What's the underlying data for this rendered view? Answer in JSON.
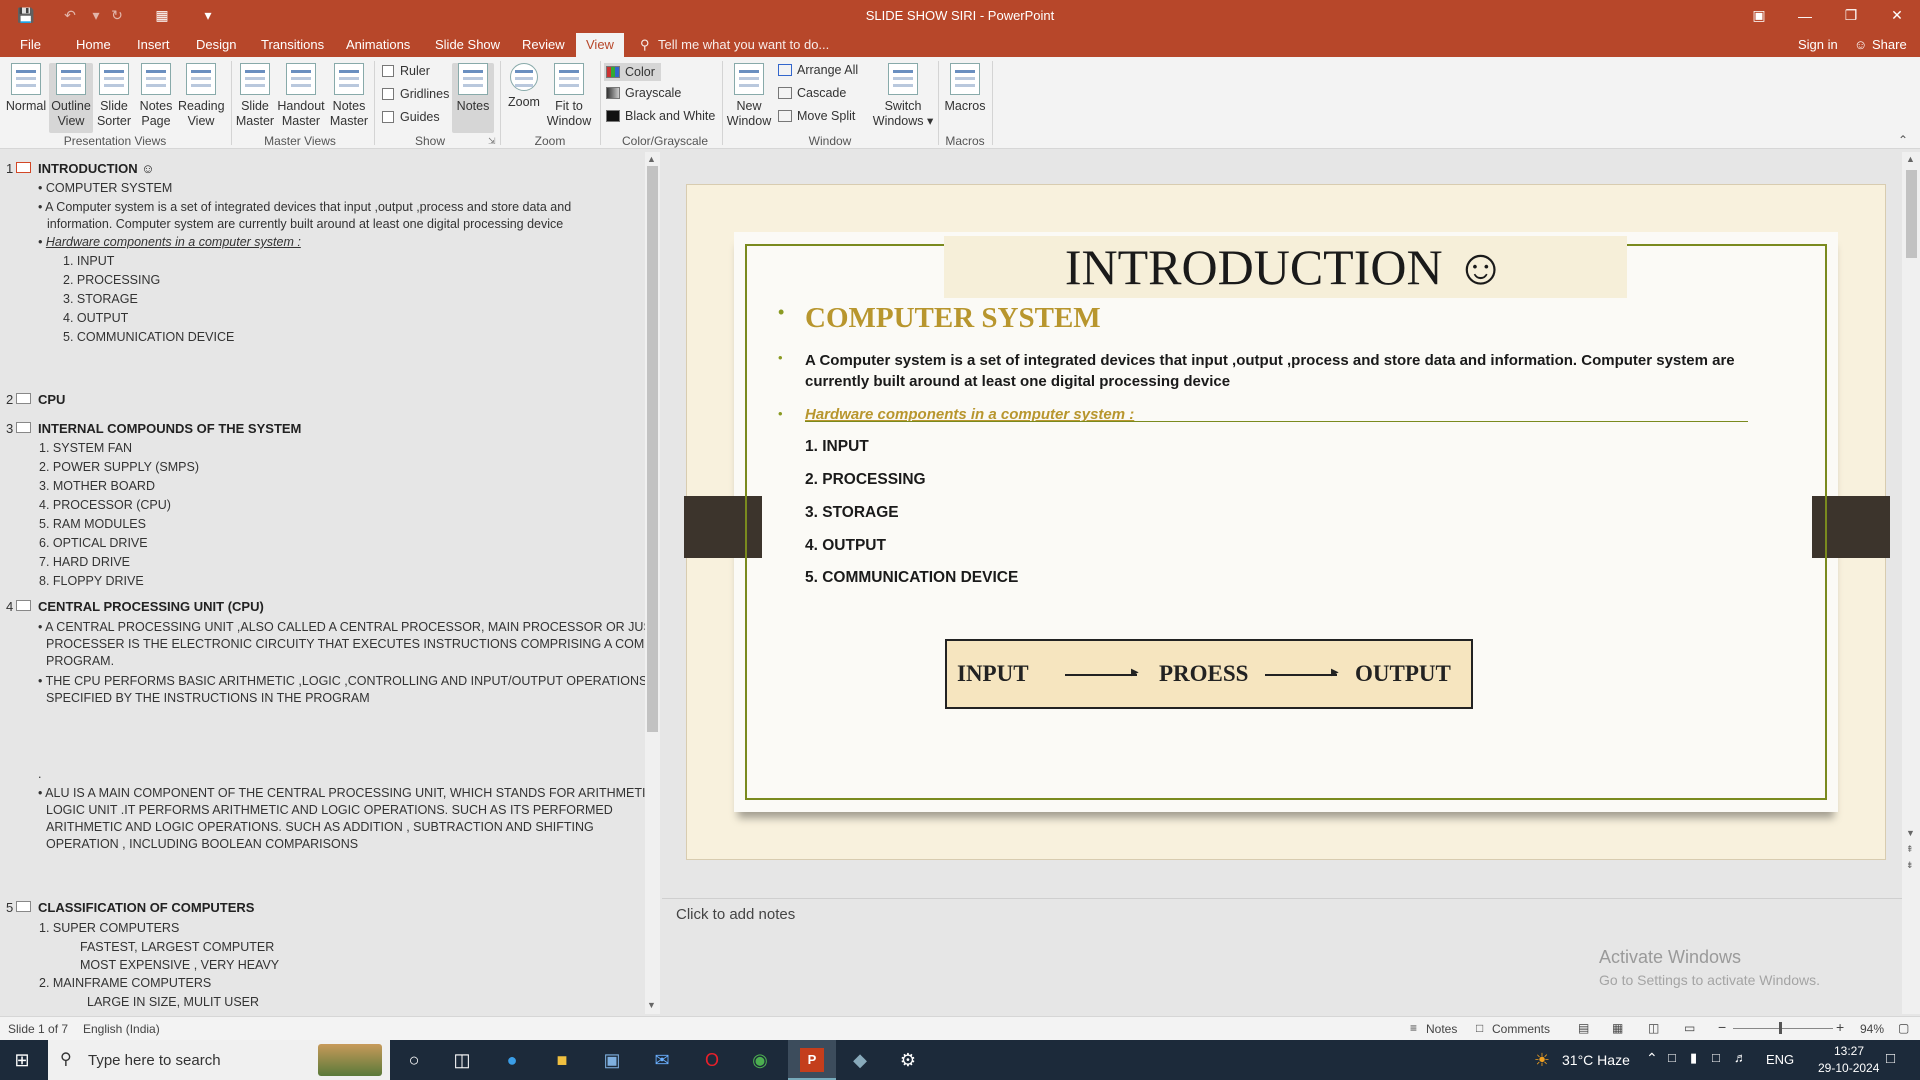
{
  "window": {
    "title": "SLIDE SHOW SIRI - PowerPoint",
    "sign_in": "Sign in",
    "share": "Share"
  },
  "tabs": [
    "File",
    "Home",
    "Insert",
    "Design",
    "Transitions",
    "Animations",
    "Slide Show",
    "Review",
    "View"
  ],
  "tell_me": "Tell me what you want to do...",
  "ribbon": {
    "presentation_views": {
      "label": "Presentation Views",
      "buttons": [
        {
          "label1": "Normal",
          "label2": ""
        },
        {
          "label1": "Outline",
          "label2": "View"
        },
        {
          "label1": "Slide",
          "label2": "Sorter"
        },
        {
          "label1": "Notes",
          "label2": "Page"
        },
        {
          "label1": "Reading",
          "label2": "View"
        }
      ]
    },
    "master_views": {
      "label": "Master Views",
      "buttons": [
        {
          "label1": "Slide",
          "label2": "Master"
        },
        {
          "label1": "Handout",
          "label2": "Master"
        },
        {
          "label1": "Notes",
          "label2": "Master"
        }
      ]
    },
    "show": {
      "label": "Show",
      "ruler": "Ruler",
      "gridlines": "Gridlines",
      "guides": "Guides",
      "notes": "Notes"
    },
    "zoom": {
      "label": "Zoom",
      "zoom": "Zoom",
      "fit1": "Fit to",
      "fit2": "Window"
    },
    "color": {
      "label": "Color/Grayscale",
      "color": "Color",
      "grayscale": "Grayscale",
      "bw": "Black and White"
    },
    "window": {
      "label": "Window",
      "new1": "New",
      "new2": "Window",
      "arrange": "Arrange All",
      "cascade": "Cascade",
      "move_split": "Move Split",
      "switch1": "Switch",
      "switch2": "Windows ▾"
    },
    "macros": {
      "label": "Macros",
      "macros": "Macros"
    }
  },
  "outline": {
    "s1": {
      "num": "1",
      "title": "INTRODUCTION ☺",
      "b1": "COMPUTER SYSTEM",
      "b2a": "A Computer system is a set of integrated devices that input ,output ,process and store data and",
      "b2b": "information. Computer system are currently built around at least one digital processing device",
      "b3": "Hardware components in a computer system :",
      "items": [
        "1. INPUT",
        "2. PROCESSING",
        "3. STORAGE",
        "4. OUTPUT",
        "5. COMMUNICATION DEVICE"
      ]
    },
    "s2": {
      "num": "2",
      "title": "CPU"
    },
    "s3": {
      "num": "3",
      "title": "INTERNAL COMPOUNDS OF THE SYSTEM",
      "items": [
        "1.  SYSTEM FAN",
        "2.  POWER SUPPLY (SMPS)",
        "3.  MOTHER BOARD",
        "4.  PROCESSOR (CPU)",
        "5.  RAM MODULES",
        "6.   OPTICAL DRIVE",
        "7.  HARD DRIVE",
        "8.  FLOPPY DRIVE"
      ]
    },
    "s4": {
      "num": "4",
      "title": "CENTRAL PROCESSING UNIT (CPU)",
      "p1": [
        "A CENTRAL PROCESSING UNIT ,ALSO CALLED A CENTRAL PROCESSOR, MAIN PROCESSOR OR JUST",
        "PROCESSER IS THE ELECTRONIC CIRCUITY THAT EXECUTES INSTRUCTIONS COMPRISING A COMPUTER",
        "PROGRAM."
      ],
      "p2": [
        "THE CPU PERFORMS BASIC ARITHMETIC ,LOGIC ,CONTROLLING AND INPUT/OUTPUT OPERATIONS",
        "SPECIFIED BY THE INSTRUCTIONS IN THE PROGRAM"
      ],
      "dot": ".",
      "p3": [
        "ALU IS A MAIN COMPONENT OF THE CENTRAL PROCESSING UNIT, WHICH STANDS FOR ARITHMETIC",
        "LOGIC UNIT  .IT  PERFORMS ARITHMETIC AND LOGIC OPERATIONS. SUCH AS ITS PERFORMED",
        "ARITHMETIC AND LOGIC OPERATIONS. SUCH AS   ADDITION , SUBTRACTION AND SHIFTING",
        "OPERATION , INCLUDING BOOLEAN COMPARISONS"
      ]
    },
    "s5": {
      "num": "5",
      "title": "CLASSIFICATION OF COMPUTERS",
      "l1": "1.  SUPER COMPUTERS",
      "l2": "FASTEST, LARGEST COMPUTER",
      "l3": "MOST EXPENSIVE , VERY HEAVY",
      "l4": "2.  MAINFRAME COMPUTERS",
      "l5": "LARGE IN SIZE, MULIT USER"
    }
  },
  "slide": {
    "title": "INTRODUCTION ☺",
    "heading": "COMPUTER SYSTEM",
    "para1": "A Computer system is a set of integrated devices that input ,output ,process and store data and information. Computer system are",
    "para2": "currently built around at least one digital processing device",
    "hw": "Hardware components in a computer system :",
    "items": [
      "1. INPUT",
      "2. PROCESSING",
      "3. STORAGE",
      "4. OUTPUT",
      "5. COMMUNICATION DEVICE"
    ],
    "flow": {
      "a": "INPUT",
      "b": "PROESS",
      "c": "OUTPUT"
    }
  },
  "notes_placeholder": "Click to add notes",
  "watermark": {
    "l1": "Activate Windows",
    "l2": "Go to Settings to activate Windows."
  },
  "status": {
    "slide": "Slide 1 of 7",
    "lang": "English (India)",
    "notes": "Notes",
    "comments": "Comments",
    "zoom": "94%",
    "zoom_level": 0.94
  },
  "taskbar": {
    "search": "Type here to search",
    "weather": "31°C  Haze",
    "lang": "ENG",
    "time": "13:27",
    "date": "29-10-2024"
  },
  "colors": {
    "accent": "#b7472a",
    "olive": "#7a8a1e",
    "gold": "#b8962e"
  }
}
